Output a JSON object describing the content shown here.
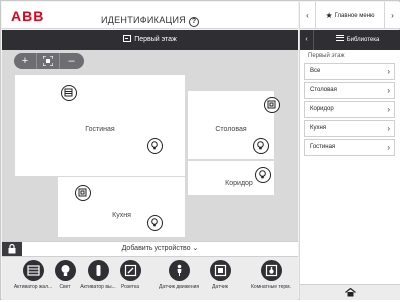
{
  "header": {
    "logo": "ABB",
    "title": "ИДЕНТИФИКАЦИЯ",
    "help_symbol": "?"
  },
  "top_nav": {
    "prev": "‹",
    "next": "›",
    "main_menu": "Главное меню"
  },
  "floor": {
    "name": "Первый этаж"
  },
  "zoom": {
    "plus": "+",
    "minus": "–"
  },
  "rooms": [
    {
      "label": "Гостиная"
    },
    {
      "label": "Столовая"
    },
    {
      "label": "Коридор"
    },
    {
      "label": "Кухня"
    }
  ],
  "add_device": {
    "label": "Добавить устройство ⌄"
  },
  "palette": [
    {
      "label": "Активатор жал...",
      "icon": "blind-actuator-icon"
    },
    {
      "label": "Свет",
      "icon": "light-icon"
    },
    {
      "label": "Активатор вы...",
      "icon": "switch-actuator-icon"
    },
    {
      "label": "Розетка",
      "icon": "socket-icon"
    },
    {
      "label": "Датчик движения",
      "icon": "motion-sensor-icon"
    },
    {
      "label": "Датчик",
      "icon": "sensor-icon"
    },
    {
      "label": "Комнатные терм...",
      "icon": "room-thermostat-icon"
    }
  ],
  "library": {
    "back": "‹",
    "title": "Библиотека",
    "section": "Первый этаж",
    "items": [
      {
        "label": "Все"
      },
      {
        "label": "Столовая"
      },
      {
        "label": "Коридор"
      },
      {
        "label": "Кухня"
      },
      {
        "label": "Гостиная"
      }
    ]
  },
  "colors": {
    "brand": "#e2001a",
    "dark_bar": "#2e2e33",
    "canvas": "#d9d9d9"
  }
}
